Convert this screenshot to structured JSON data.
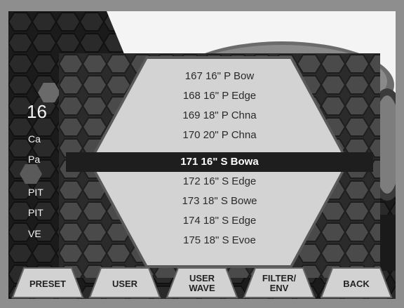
{
  "background": {
    "title_fragment": "16",
    "labels": [
      "Ca",
      "Pa",
      "PIT",
      "PIT",
      "VE"
    ]
  },
  "list": {
    "items": [
      "167 16\" P Bow",
      "168 16\" P Edge",
      "169 18\" P Chna",
      "170 20\" P Chna",
      "171 16\" S Bowa",
      "172 16\" S Edge",
      "173 18\" S Bowe",
      "174 18\" S Edge",
      "175 18\" S Evoe"
    ],
    "selected_index": 4
  },
  "tabs": [
    {
      "label": "PRESET"
    },
    {
      "label": "USER"
    },
    {
      "label": "USER WAVE",
      "line1": "USER",
      "line2": "WAVE"
    },
    {
      "label": "FILTER/ ENV",
      "line1": "FILTER/",
      "line2": "ENV"
    },
    {
      "label": "BACK"
    }
  ],
  "colors": {
    "frame": "#8e8e8e",
    "screen_bg": "#1a1a1a",
    "hex_popup": "#c9c9c9",
    "selection_bar": "#1e1e1e",
    "tab_fill": "#d2d2d2"
  }
}
